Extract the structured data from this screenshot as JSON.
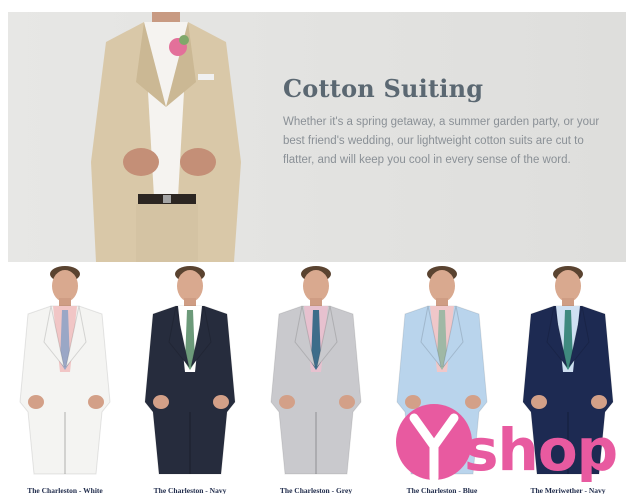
{
  "hero": {
    "title": "Cotton Suiting",
    "body": "Whether it's a spring getaway, a summer garden party, or your best friend's wedding, our lightweight cotton suits are cut to flatter, and will keep you cool in every sense of the word."
  },
  "products": [
    {
      "name": "The Charleston - White",
      "suit_color": "#f4f4f2",
      "shirt_color": "#f1c6c6",
      "tie_color": "#9aa7c6"
    },
    {
      "name": "The Charleston - Navy",
      "suit_color": "#262c3d",
      "shirt_color": "#ffffff",
      "tie_color": "#6c9a7a"
    },
    {
      "name": "The Charleston - Grey",
      "suit_color": "#c9c9cd",
      "shirt_color": "#e7c1cf",
      "tie_color": "#3d6d8a"
    },
    {
      "name": "The Charleston - Blue",
      "suit_color": "#b9d4ec",
      "shirt_color": "#f0c7c9",
      "tie_color": "#9fb8a5"
    },
    {
      "name": "The Meriwether - Navy",
      "suit_color": "#1d2a52",
      "shirt_color": "#cfe0f2",
      "tie_color": "#3f8a7f"
    }
  ],
  "watermark": {
    "text": "shop",
    "color": "#e85aa0"
  }
}
